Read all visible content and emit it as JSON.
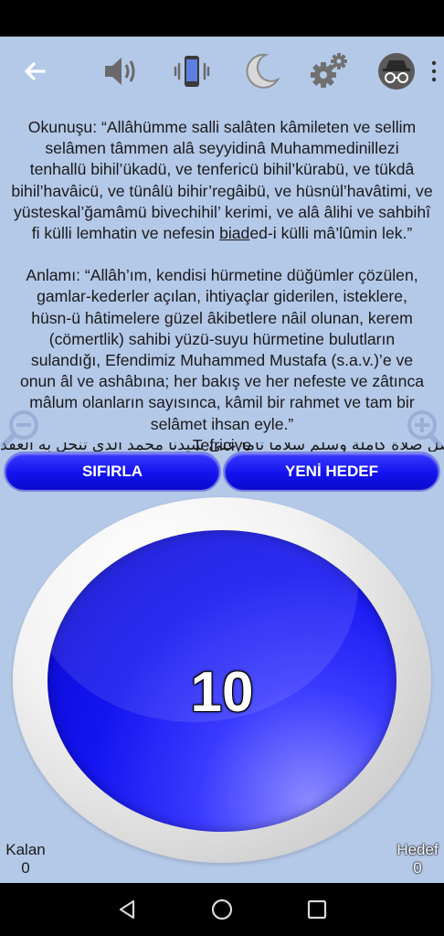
{
  "toolbar": {
    "icons": [
      "back-arrow-icon",
      "volume-icon",
      "vibrate-icon",
      "night-mode-icon",
      "settings-icon",
      "incognito-icon"
    ]
  },
  "text": {
    "okunusu_lines": [
      "Okunuşu: “Allâhümme salli salâten kâmileten ve sellim",
      "selâmen tâmmen alâ seyyidinâ Muhammedinillezi",
      "tenhallü bihil’ükadü, ve tenfericü bihil’kürabü, ve tükdâ",
      "bihil’havâicü, ve tünâlü bihir’regâibü, ve hüsnül’havâtimi, ve",
      "yüsteskal’ğamâmü bivechihil’ kerimi, ve alâ âlihi ve sahbihî"
    ],
    "okunusu_last_before": "fi külli lemhatin ve nefesin ",
    "okunusu_last_underlined": "biad",
    "okunusu_last_after": "ed-i külli mâ’lûmin lek.”",
    "anlami_lines": [
      "Anlamı: “Allâh’ım, kendisi hürmetine düğümler çözülen,",
      "gamlar-kederler açılan, ihtiyaçlar giderilen, isteklere,",
      "hüsn-ü hâtimelere güzel âkibetlere nâil olunan, kerem",
      "(cömertlik) sahibi yüzü-suyu hürmetine bulutların",
      "sulandığı, Efendimiz Muhammed Mustafa (s.a.v.)’e ve",
      "onun âl ve ashâbına; her bakış ve her nefeste ve zâtınca",
      "mâlum olanların sayısınca, kâmil bir rahmet ve tam bir",
      "selâmet ihsan eyle.”"
    ],
    "tefriciye": "Tefriciye",
    "cut_line": "اللهم صل صلاة كاملة وسلم سلاما تاما على سيدنا محمد الذي تنحل به العقد"
  },
  "buttons": {
    "reset_label": "SIFIRLA",
    "new_target_label": "YENİ HEDEF"
  },
  "counter": {
    "count": "10"
  },
  "stats": {
    "kalan_label": "Kalan",
    "kalan_value": "0",
    "hedef_label": "Hedef",
    "hedef_value": "0"
  },
  "colors": {
    "background": "#b4c8e8",
    "button_blue": "#1212ee",
    "counter_blue": "#1414f0"
  }
}
